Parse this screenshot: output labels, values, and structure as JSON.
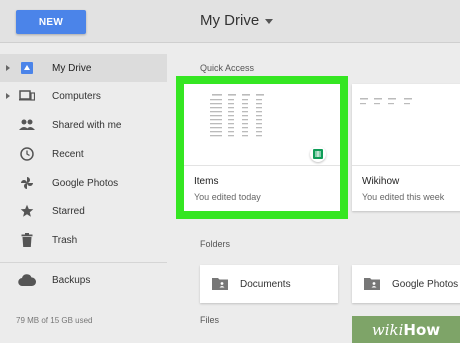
{
  "topbar": {
    "new_label": "NEW",
    "title": "My Drive"
  },
  "sidebar": {
    "items": [
      {
        "label": "My Drive",
        "icon": "drive-icon",
        "active": true,
        "expandable": true
      },
      {
        "label": "Computers",
        "icon": "computers-icon",
        "active": false,
        "expandable": true
      },
      {
        "label": "Shared with me",
        "icon": "people-icon",
        "active": false,
        "expandable": false
      },
      {
        "label": "Recent",
        "icon": "clock-icon",
        "active": false,
        "expandable": false
      },
      {
        "label": "Google Photos",
        "icon": "pinwheel-icon",
        "active": false,
        "expandable": false
      },
      {
        "label": "Starred",
        "icon": "star-icon",
        "active": false,
        "expandable": false
      },
      {
        "label": "Trash",
        "icon": "trash-icon",
        "active": false,
        "expandable": false
      }
    ],
    "backups_label": "Backups",
    "storage": "79 MB of 15 GB used"
  },
  "main": {
    "quick_access_label": "Quick Access",
    "cards": [
      {
        "name": "Items",
        "sub": "You edited today"
      },
      {
        "name": "Wikihow",
        "sub": "You edited this week"
      }
    ],
    "folders_label": "Folders",
    "folders": [
      {
        "name": "Documents"
      },
      {
        "name": "Google Photos"
      }
    ],
    "files_label": "Files"
  },
  "colors": {
    "accent": "#4b84e9",
    "highlight": "#35e622",
    "sheets": "#0f9d58"
  },
  "watermark": {
    "prefix": "wiki",
    "suffix": "How"
  }
}
